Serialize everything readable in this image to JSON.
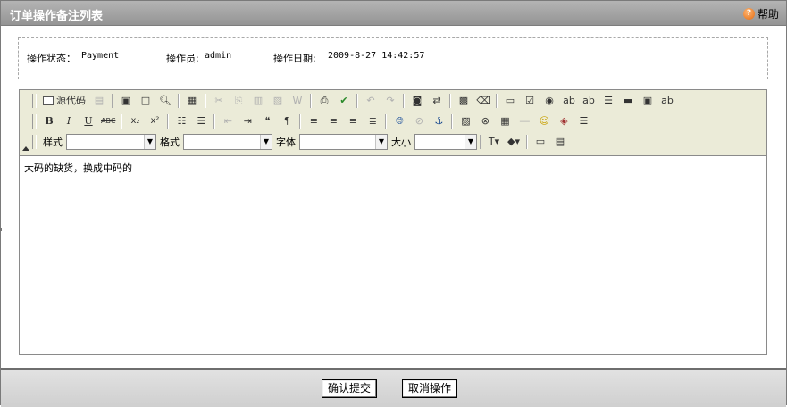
{
  "window": {
    "title": "订单操作备注列表",
    "help_label": "帮助",
    "help_icon": "help-icon"
  },
  "info": {
    "status_label": "操作状态：",
    "status_value": "Payment",
    "operator_label": "操作员:",
    "operator_value": "admin",
    "date_label": "操作日期:",
    "date_value": "2009-8-27 14:42:57"
  },
  "toolbar": {
    "source_label": "源代码",
    "style_label": "样式",
    "format_label": "格式",
    "font_label": "字体",
    "size_label": "大小",
    "style_value": "",
    "format_value": "",
    "font_value": "",
    "size_value": ""
  },
  "editor": {
    "content": "大码的缺货，换成中码的"
  },
  "footer": {
    "confirm_label": "确认提交",
    "cancel_label": "取消操作"
  }
}
